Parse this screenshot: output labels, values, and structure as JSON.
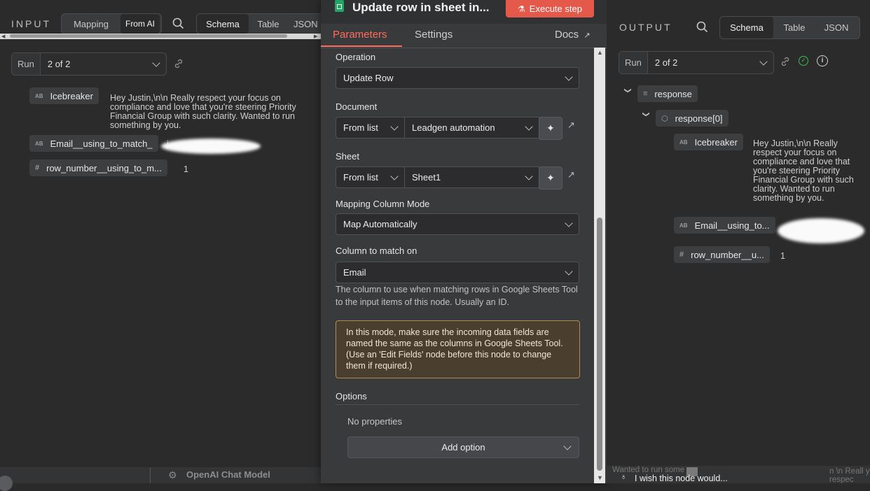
{
  "input": {
    "label": "INPUT",
    "mode_tabs": [
      "Mapping",
      "From AI"
    ],
    "view_tabs": [
      "Schema",
      "Table",
      "JSON"
    ],
    "run_label": "Run",
    "run_value": "2 of 2",
    "fields": [
      {
        "type": "AB",
        "name": "Icebreaker",
        "value": "Hey Justin,\\n\\n Really respect your focus on compliance and love that you're steering Priority Financial Group with such clarity. Wanted to run something by you."
      },
      {
        "type": "AB",
        "name": "Email__using_to_match_",
        "value": "j"
      },
      {
        "type": "#",
        "name": "row_number__using_to_m...",
        "value": "1"
      }
    ],
    "footer_node": "OpenAI Chat Model"
  },
  "node": {
    "title": "Update row in sheet in...",
    "execute_label": "Execute step",
    "tabs": [
      "Parameters",
      "Settings"
    ],
    "docs_label": "Docs",
    "operation_label": "Operation",
    "operation_value": "Update Row",
    "document_label": "Document",
    "document_mode": "From list",
    "document_value": "Leadgen automation",
    "sheet_label": "Sheet",
    "sheet_mode": "From list",
    "sheet_value": "Sheet1",
    "mapping_label": "Mapping Column Mode",
    "mapping_value": "Map Automatically",
    "match_label": "Column to match on",
    "match_value": "Email",
    "match_hint": "The column to use when matching rows in Google Sheets Tool to the input items of this node. Usually an ID.",
    "notice": "In this mode, make sure the incoming data fields are named the same as the columns in Google Sheets Tool. (Use an 'Edit Fields' node before this node to change them if required.)",
    "options_label": "Options",
    "no_properties": "No properties",
    "add_option_label": "Add option"
  },
  "output": {
    "label": "OUTPUT",
    "view_tabs": [
      "Schema",
      "Table",
      "JSON"
    ],
    "run_label": "Run",
    "run_value": "2 of 2",
    "tree_root": "response",
    "tree_child": "response[0]",
    "fields": [
      {
        "type": "AB",
        "name": "Icebreaker",
        "value": "Hey Justin,\\n\\n Really respect your focus on compliance and love that you're steering Priority Financial Group with such clarity. Wanted to run something by you."
      },
      {
        "type": "AB",
        "name": "Email__using_to...",
        "value": ""
      },
      {
        "type": "#",
        "name": "row_number__u...",
        "value": "1"
      }
    ],
    "footer_left": "Wanted to run some",
    "footer_feedback": "I wish this node would...",
    "footer_right": "n \\n Reall y respec"
  },
  "colors": {
    "accent": "#ff6d5a",
    "execute_bg": "#e5594b",
    "success": "#3fb950",
    "sheet_green": "#21a464"
  }
}
